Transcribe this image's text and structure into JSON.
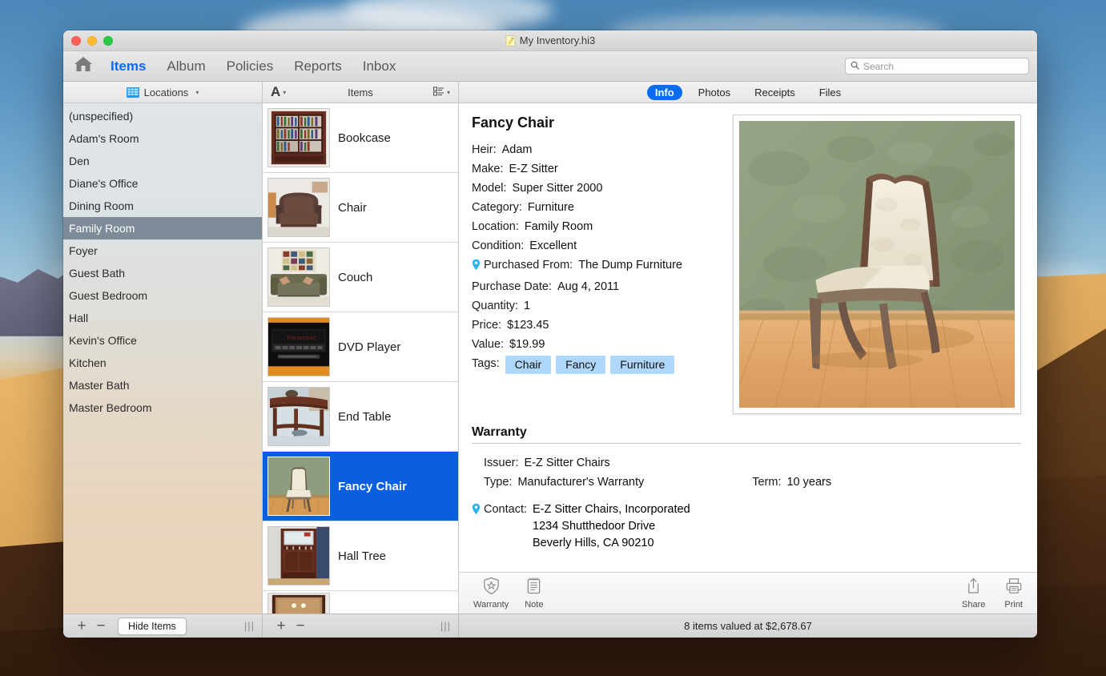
{
  "window": {
    "title": "My Inventory.hi3",
    "doc_icon": "document-icon"
  },
  "toolbar": {
    "home_icon": "home-icon",
    "tabs": [
      {
        "label": "Items",
        "active": true
      },
      {
        "label": "Album",
        "active": false
      },
      {
        "label": "Policies",
        "active": false
      },
      {
        "label": "Reports",
        "active": false
      },
      {
        "label": "Inbox",
        "active": false
      }
    ],
    "search": {
      "placeholder": "Search",
      "value": "",
      "icon": "search-icon"
    }
  },
  "column_headers": {
    "locations": {
      "label": "Locations",
      "icon": "grid-table-icon",
      "caret": "▾"
    },
    "items": {
      "sort_icon": "A",
      "label": "Items",
      "view_icon": "list-view-icon",
      "caret": "▾"
    },
    "detail_tabs": [
      {
        "label": "Info",
        "active": true
      },
      {
        "label": "Photos",
        "active": false
      },
      {
        "label": "Receipts",
        "active": false
      },
      {
        "label": "Files",
        "active": false
      }
    ]
  },
  "sidebar": {
    "items": [
      {
        "label": "(unspecified)",
        "selected": false
      },
      {
        "label": "Adam's Room",
        "selected": false
      },
      {
        "label": "Den",
        "selected": false
      },
      {
        "label": "Diane's Office",
        "selected": false
      },
      {
        "label": "Dining Room",
        "selected": false
      },
      {
        "label": "Family Room",
        "selected": true
      },
      {
        "label": "Foyer",
        "selected": false
      },
      {
        "label": "Guest Bath",
        "selected": false
      },
      {
        "label": "Guest Bedroom",
        "selected": false
      },
      {
        "label": "Hall",
        "selected": false
      },
      {
        "label": "Kevin's Office",
        "selected": false
      },
      {
        "label": "Kitchen",
        "selected": false
      },
      {
        "label": "Master Bath",
        "selected": false
      },
      {
        "label": "Master Bedroom",
        "selected": false
      }
    ]
  },
  "item_list": {
    "rows": [
      {
        "label": "Bookcase",
        "selected": false,
        "thumb": "bookcase-thumb"
      },
      {
        "label": "Chair",
        "selected": false,
        "thumb": "chair-thumb"
      },
      {
        "label": "Couch",
        "selected": false,
        "thumb": "couch-thumb"
      },
      {
        "label": "DVD Player",
        "selected": false,
        "thumb": "dvd-player-thumb"
      },
      {
        "label": "End Table",
        "selected": false,
        "thumb": "end-table-thumb"
      },
      {
        "label": "Fancy Chair",
        "selected": true,
        "thumb": "fancy-chair-thumb"
      },
      {
        "label": "Hall Tree",
        "selected": false,
        "thumb": "hall-tree-thumb"
      },
      {
        "label": "",
        "selected": false,
        "thumb": "cabinet-thumb"
      }
    ]
  },
  "detail": {
    "title": "Fancy Chair",
    "fields": [
      {
        "label": "Heir:",
        "value": "Adam",
        "pin": false
      },
      {
        "label": "Make:",
        "value": "E-Z Sitter",
        "pin": false
      },
      {
        "label": "Model:",
        "value": "Super Sitter 2000",
        "pin": false
      },
      {
        "label": "Category:",
        "value": "Furniture",
        "pin": false
      },
      {
        "label": "Location:",
        "value": "Family Room",
        "pin": false
      },
      {
        "label": "Condition:",
        "value": "Excellent",
        "pin": false
      },
      {
        "label": "Purchased From:",
        "value": "The Dump Furniture",
        "pin": true
      },
      {
        "label": "Purchase Date:",
        "value": "Aug 4, 2011",
        "pin": false
      },
      {
        "label": "Quantity:",
        "value": "1",
        "pin": false
      },
      {
        "label": "Price:",
        "value": "$123.45",
        "pin": false
      },
      {
        "label": "Value:",
        "value": "$19.99",
        "pin": false
      }
    ],
    "tags_label": "Tags:",
    "tags": [
      "Chair",
      "Fancy",
      "Furniture"
    ],
    "photo_alt": "fancy-chair-photo",
    "warranty": {
      "heading": "Warranty",
      "issuer_label": "Issuer:",
      "issuer_value": "E-Z Sitter Chairs",
      "type_label": "Type:",
      "type_value": "Manufacturer's Warranty",
      "term_label": "Term:",
      "term_value": "10 years",
      "contact_label": "Contact:",
      "contact_lines": [
        "E-Z Sitter Chairs, Incorporated",
        "1234 Shutthedoor Drive",
        "Beverly Hills, CA 90210"
      ]
    },
    "bottom_buttons": [
      {
        "label": "Warranty",
        "icon": "shield-star-icon"
      },
      {
        "label": "Note",
        "icon": "note-icon"
      }
    ],
    "right_buttons": [
      {
        "label": "Share",
        "icon": "share-icon"
      },
      {
        "label": "Print",
        "icon": "print-icon"
      }
    ]
  },
  "statusbar": {
    "add_label": "+",
    "remove_label": "−",
    "hide_items_label": "Hide Items",
    "status_text": "8 items valued at $2,678.67",
    "grip": "|||"
  },
  "colors": {
    "accent_blue": "#0a6cf1",
    "selection_blue": "#0a5fe0",
    "sidebar_selection": "#7e8c99",
    "tag_blue": "#aed7fb",
    "pin_cyan": "#2bb3f0"
  }
}
